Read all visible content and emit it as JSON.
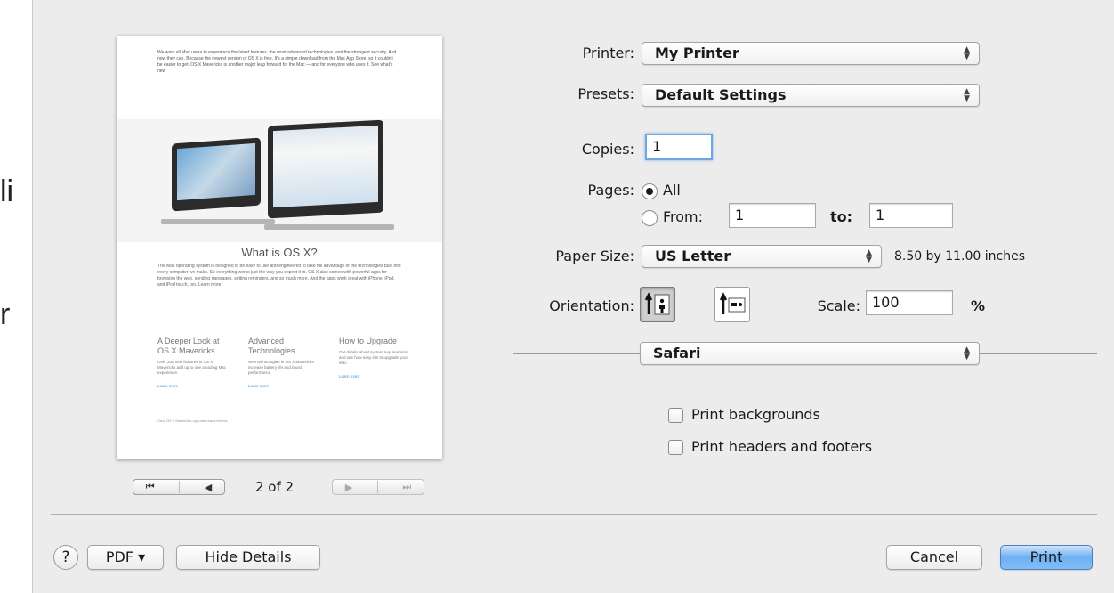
{
  "background": {
    "left_text_1": "li",
    "left_text_2": "r"
  },
  "preview": {
    "intro": "We want all Mac users to experience the latest features, the most advanced technologies, and the strongest security. And now they can. Because the newest version of OS X is free. It's a simple download from the Mac App Store, so it couldn't be easier to get. OS X Mavericks is another major leap forward for the Mac — and for everyone who uses it. See what's new",
    "title": "What is OS X?",
    "body": "The Mac operating system is designed to be easy to use and engineered to take full advantage of the technologies built into every computer we make. So everything works just the way you expect it to. OS X also comes with powerful apps for browsing the web, sending messages, setting reminders, and so much more. And the apps work great with iPhone, iPad, and iPod touch, too. Learn more",
    "columns": [
      {
        "heading": "A Deeper Look at OS X Mavericks",
        "text": "Over 200 new features in OS X Mavericks add up to one amazing Mac experience.",
        "link": "Learn more"
      },
      {
        "heading": "Advanced Technologies",
        "text": "New technologies in OS X Mavericks increase battery life and boost performance.",
        "link": "Learn more"
      },
      {
        "heading": "How to Upgrade",
        "text": "Get details about system requirements and see how easy it is to upgrade your Mac.",
        "link": "Learn more"
      }
    ],
    "footer": "View OS X Mavericks upgrade requirements"
  },
  "navigation": {
    "first": "⏮",
    "prev": "◀",
    "next": "▶",
    "last": "⏭",
    "page_indicator": "2 of 2"
  },
  "form": {
    "printer_label": "Printer:",
    "printer_value": "My Printer",
    "presets_label": "Presets:",
    "presets_value": "Default Settings",
    "copies_label": "Copies:",
    "copies_value": "1",
    "pages_label": "Pages:",
    "pages_all": "All",
    "pages_from": "From:",
    "from_value": "1",
    "to_label": "to:",
    "to_value": "1",
    "paper_label": "Paper Size:",
    "paper_value": "US Letter",
    "paper_dims": "8.50 by 11.00 inches",
    "orientation_label": "Orientation:",
    "scale_label": "Scale:",
    "scale_value": "100",
    "scale_unit": "%",
    "section_value": "Safari",
    "print_backgrounds": "Print backgrounds",
    "print_headers": "Print headers and footers"
  },
  "buttons": {
    "help": "?",
    "pdf": "PDF ▾",
    "hide_details": "Hide Details",
    "cancel": "Cancel",
    "print": "Print"
  },
  "colors": {
    "default_button": "#6fb0f3",
    "sheet_bg": "#ececec",
    "focus_ring": "#6fa6e2"
  }
}
